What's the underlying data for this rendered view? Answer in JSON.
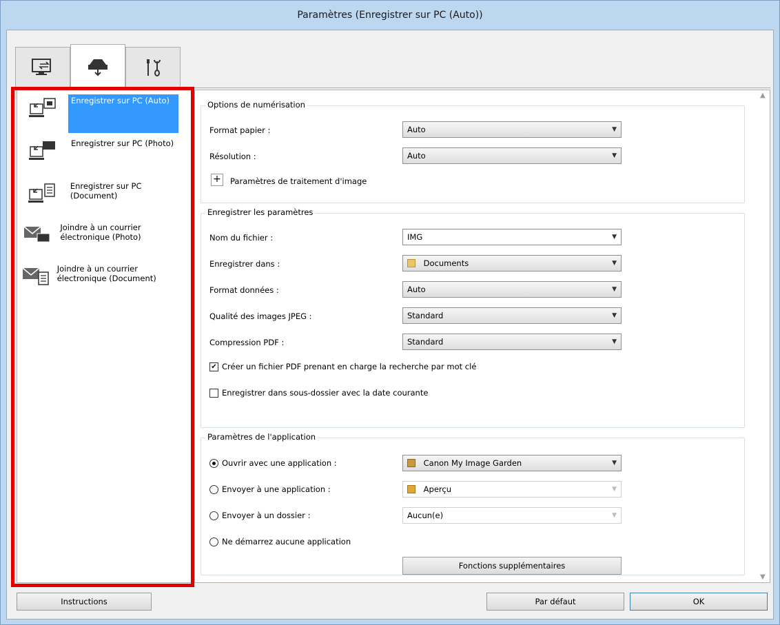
{
  "window": {
    "title": "Paramètres (Enregistrer sur PC (Auto))"
  },
  "tabs": [
    {
      "icon": "scan-from-computer-icon"
    },
    {
      "icon": "scan-from-panel-icon"
    },
    {
      "icon": "general-settings-icon"
    }
  ],
  "nav": {
    "items": [
      {
        "label": "Enregistrer sur PC (Auto)",
        "icon": "save-to-pc-icon"
      },
      {
        "label": "Enregistrer sur PC (Photo)",
        "icon": "save-photo-icon"
      },
      {
        "label": "Enregistrer sur PC (Document)",
        "icon": "save-document-icon"
      },
      {
        "label": "Joindre à un courrier électronique (Photo)",
        "icon": "email-photo-icon"
      },
      {
        "label": "Joindre à un courrier électronique (Document)",
        "icon": "email-document-icon"
      }
    ]
  },
  "scan_options": {
    "title": "Options de numérisation",
    "paper_size_label": "Format papier :",
    "paper_size_value": "Auto",
    "resolution_label": "Résolution :",
    "resolution_value": "Auto",
    "image_processing_label": "Paramètres de traitement d'image"
  },
  "save_settings": {
    "title": "Enregistrer les paramètres",
    "file_name_label": "Nom du fichier :",
    "file_name_value": "IMG",
    "save_in_label": "Enregistrer dans :",
    "save_in_value": "Documents",
    "data_format_label": "Format données :",
    "data_format_value": "Auto",
    "jpeg_quality_label": "Qualité des images JPEG :",
    "jpeg_quality_value": "Standard",
    "pdf_compression_label": "Compression PDF :",
    "pdf_compression_value": "Standard",
    "searchable_pdf_label": "Créer un fichier PDF prenant en charge la recherche par mot clé",
    "searchable_pdf_checked": true,
    "subfolder_label": "Enregistrer dans sous-dossier avec la date courante",
    "subfolder_checked": false
  },
  "app_settings": {
    "title": "Paramètres de l'application",
    "open_app_label": "Ouvrir avec une application :",
    "open_app_value": "Canon My Image Garden",
    "send_app_label": "Envoyer à une application :",
    "send_app_value": "Aperçu",
    "send_folder_label": "Envoyer à un dossier :",
    "send_folder_value": "Aucun(e)",
    "no_app_label": "Ne démarrez aucune application",
    "selected": "open_app",
    "more_functions_label": "Fonctions supplémentaires"
  },
  "footer": {
    "instructions_label": "Instructions",
    "defaults_label": "Par défaut",
    "ok_label": "OK"
  },
  "colors": {
    "title_bar": "#bcd7f0",
    "selection": "#3399ff",
    "highlight_frame": "#e00000"
  }
}
